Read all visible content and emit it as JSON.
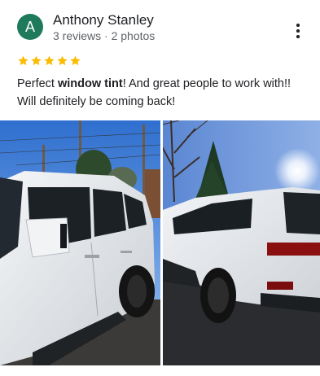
{
  "review": {
    "author_initial": "A",
    "author_name": "Anthony Stanley",
    "author_meta": "3 reviews · 2 photos",
    "rating": 5,
    "text_before": "Perfect ",
    "text_bold": "window tint",
    "text_after": "! And great people to work with!! Will definitely be coming back!"
  },
  "icons": {
    "more": "more-vert-icon",
    "star": "star-icon"
  },
  "colors": {
    "avatar": "#1e7a5a",
    "star": "#fbbc04",
    "text": "#202124",
    "meta": "#5f6368"
  },
  "photos": [
    {
      "name": "photo-white-suv-front"
    },
    {
      "name": "photo-white-suv-rear"
    }
  ]
}
